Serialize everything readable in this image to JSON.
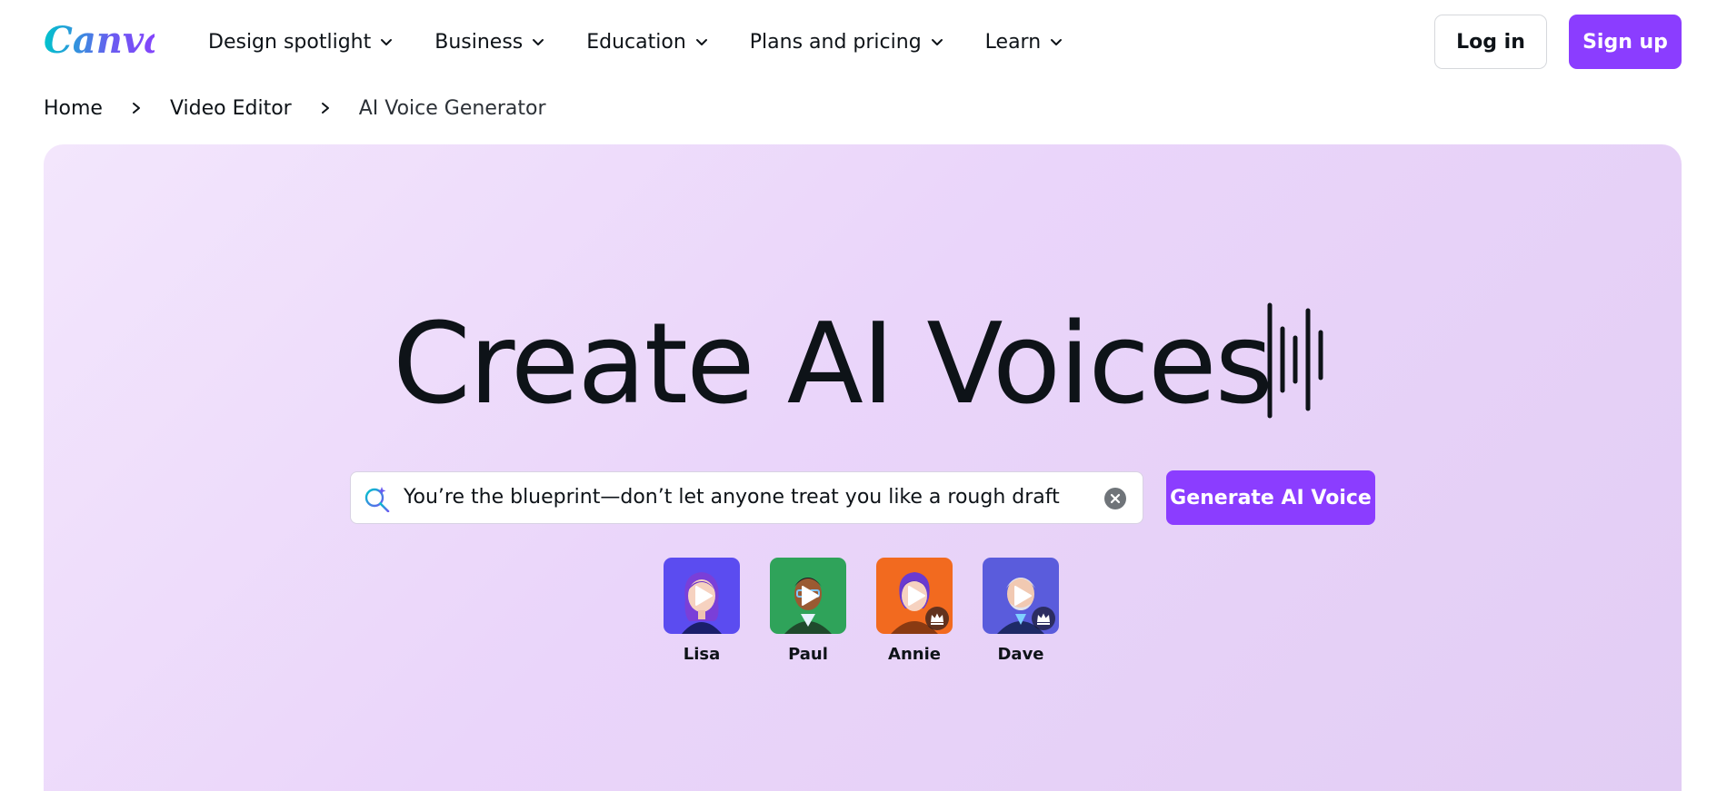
{
  "header": {
    "logo_text": "Canva",
    "nav": [
      {
        "label": "Design spotlight"
      },
      {
        "label": "Business"
      },
      {
        "label": "Education"
      },
      {
        "label": "Plans and pricing"
      },
      {
        "label": "Learn"
      }
    ],
    "login_label": "Log in",
    "signup_label": "Sign up"
  },
  "breadcrumb": [
    {
      "label": "Home"
    },
    {
      "label": "Video Editor"
    },
    {
      "label": "AI Voice Generator"
    }
  ],
  "hero": {
    "title": "Create AI Voices",
    "search": {
      "value": "You’re the blueprint—don’t let anyone treat you like a rough draft"
    },
    "generate_label": "Generate AI Voice",
    "voices": [
      {
        "name": "Lisa",
        "bg": "#5b4cf0",
        "premium": false
      },
      {
        "name": "Paul",
        "bg": "#2fa35a",
        "premium": false
      },
      {
        "name": "Annie",
        "bg": "#f26a1f",
        "premium": true
      },
      {
        "name": "Dave",
        "bg": "#5a5cdc",
        "premium": true
      }
    ]
  },
  "colors": {
    "accent": "#8b3dff",
    "text": "#0e1318",
    "hero_bg_start": "#f3e6fc",
    "hero_bg_end": "#e2cdf4"
  },
  "icons": [
    "chevron-down-icon",
    "chevron-right-icon",
    "magic-search-icon",
    "clear-icon",
    "audio-wave-icon",
    "play-icon",
    "crown-icon"
  ]
}
